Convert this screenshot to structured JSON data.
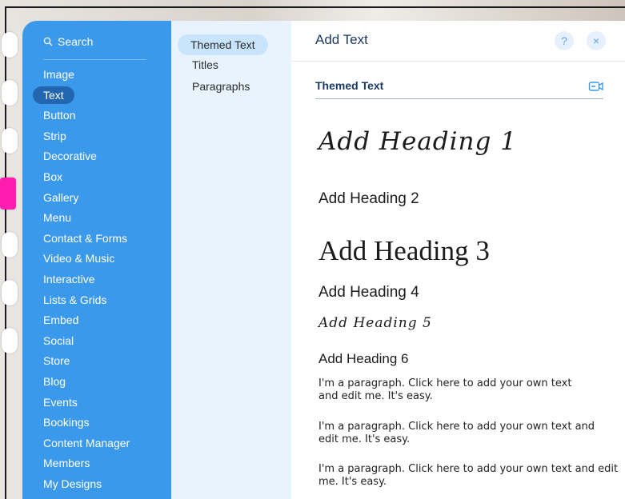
{
  "categories": {
    "search_label": "Search",
    "items": [
      "Image",
      "Text",
      "Button",
      "Strip",
      "Decorative",
      "Box",
      "Gallery",
      "Menu",
      "Contact & Forms",
      "Video & Music",
      "Interactive",
      "Lists & Grids",
      "Embed",
      "Social",
      "Store",
      "Blog",
      "Events",
      "Bookings",
      "Content Manager",
      "Members",
      "My Designs"
    ],
    "active": "Text"
  },
  "subcategories": {
    "items": [
      "Themed Text",
      "Titles",
      "Paragraphs"
    ],
    "active": "Themed Text"
  },
  "panel": {
    "title": "Add Text",
    "help_label": "?",
    "close_label": "×",
    "section_title": "Themed Text",
    "icons": [
      "search-icon",
      "help-icon",
      "close-icon",
      "video-icon"
    ]
  },
  "text_presets": {
    "heading1": "Add Heading 1",
    "heading2": "Add Heading 2",
    "heading3": "Add Heading 3",
    "heading4": "Add Heading 4",
    "heading5": "Add Heading 5",
    "heading6": "Add Heading 6",
    "paragraph1": "I'm a paragraph. Click here to add your own text and edit me. It's easy.",
    "paragraph2": "I'm a paragraph. Click here to add your own text and edit me. It's easy.",
    "paragraph3": "I'm a paragraph. Click here to add your own text and edit me. It's easy."
  },
  "colors": {
    "category_bg": "#3b99ec",
    "category_active": "#2266b0",
    "subcategory_bg": "#e8f3fe",
    "accent": "#5c9ff1",
    "title": "#1b3a62",
    "toolbar_highlight": "#ff1db0"
  }
}
